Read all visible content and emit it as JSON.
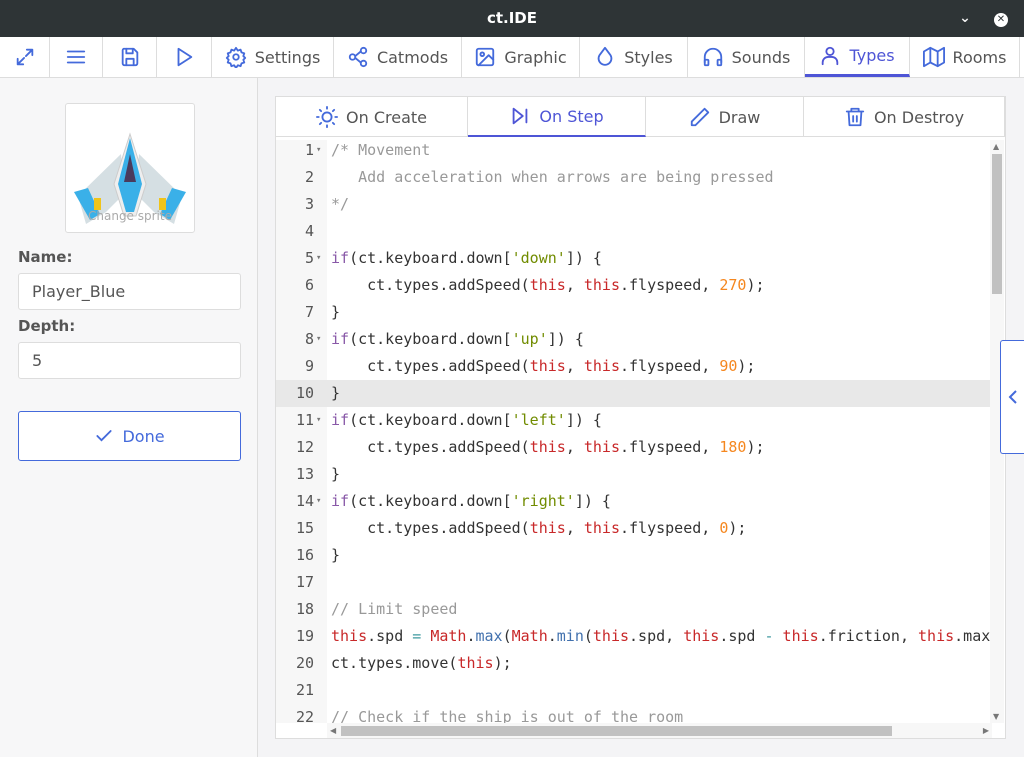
{
  "window": {
    "title": "ct.IDE"
  },
  "toolbar": {
    "tabs": [
      {
        "label": "",
        "icon": "expand-icon"
      },
      {
        "label": "",
        "icon": "menu-icon"
      },
      {
        "label": "",
        "icon": "save-icon"
      },
      {
        "label": "",
        "icon": "play-icon"
      },
      {
        "label": "Settings",
        "icon": "gear-icon"
      },
      {
        "label": "Catmods",
        "icon": "share-nodes-icon"
      },
      {
        "label": "Graphic",
        "icon": "image-icon"
      },
      {
        "label": "Styles",
        "icon": "droplet-icon"
      },
      {
        "label": "Sounds",
        "icon": "headphones-icon"
      },
      {
        "label": "Types",
        "icon": "user-icon",
        "active": true
      },
      {
        "label": "Rooms",
        "icon": "map-icon"
      }
    ]
  },
  "left": {
    "sprite_caption": "Change sprite",
    "name_label": "Name:",
    "name_value": "Player_Blue",
    "depth_label": "Depth:",
    "depth_value": "5",
    "done_label": "Done"
  },
  "editor": {
    "tabs": [
      {
        "label": "On Create",
        "icon": "sun-icon"
      },
      {
        "label": "On Step",
        "icon": "skip-forward-icon",
        "active": true
      },
      {
        "label": "Draw",
        "icon": "pencil-icon"
      },
      {
        "label": "On Destroy",
        "icon": "trash-icon"
      }
    ],
    "current_line": 10,
    "lines": [
      [
        [
          "cm",
          "/* Movement"
        ]
      ],
      [
        [
          "cm",
          "   Add acceleration when arrows are being pressed"
        ]
      ],
      [
        [
          "cm",
          "*/"
        ]
      ],
      [],
      [
        [
          "kw",
          "if"
        ],
        [
          "",
          "(ct.keyboard.down["
        ],
        [
          "st",
          "'down'"
        ],
        [
          "",
          "]) {"
        ]
      ],
      [
        [
          "",
          "    ct.types.addSpeed("
        ],
        [
          "th",
          "this"
        ],
        [
          "",
          ", "
        ],
        [
          "th",
          "this"
        ],
        [
          "",
          ".flyspeed, "
        ],
        [
          "nu",
          "270"
        ],
        [
          "",
          ");"
        ]
      ],
      [
        [
          "",
          "}"
        ]
      ],
      [
        [
          "kw",
          "if"
        ],
        [
          "",
          "(ct.keyboard.down["
        ],
        [
          "st",
          "'up'"
        ],
        [
          "",
          "]) {"
        ]
      ],
      [
        [
          "",
          "    ct.types.addSpeed("
        ],
        [
          "th",
          "this"
        ],
        [
          "",
          ", "
        ],
        [
          "th",
          "this"
        ],
        [
          "",
          ".flyspeed, "
        ],
        [
          "nu",
          "90"
        ],
        [
          "",
          ");"
        ]
      ],
      [
        [
          "",
          "}"
        ]
      ],
      [
        [
          "kw",
          "if"
        ],
        [
          "",
          "(ct.keyboard.down["
        ],
        [
          "st",
          "'left'"
        ],
        [
          "",
          "]) {"
        ]
      ],
      [
        [
          "",
          "    ct.types.addSpeed("
        ],
        [
          "th",
          "this"
        ],
        [
          "",
          ", "
        ],
        [
          "th",
          "this"
        ],
        [
          "",
          ".flyspeed, "
        ],
        [
          "nu",
          "180"
        ],
        [
          "",
          ");"
        ]
      ],
      [
        [
          "",
          "}"
        ]
      ],
      [
        [
          "kw",
          "if"
        ],
        [
          "",
          "(ct.keyboard.down["
        ],
        [
          "st",
          "'right'"
        ],
        [
          "",
          "]) {"
        ]
      ],
      [
        [
          "",
          "    ct.types.addSpeed("
        ],
        [
          "th",
          "this"
        ],
        [
          "",
          ", "
        ],
        [
          "th",
          "this"
        ],
        [
          "",
          ".flyspeed, "
        ],
        [
          "nu",
          "0"
        ],
        [
          "",
          ");"
        ]
      ],
      [
        [
          "",
          "}"
        ]
      ],
      [],
      [
        [
          "cm",
          "// Limit speed"
        ]
      ],
      [
        [
          "th",
          "this"
        ],
        [
          "",
          ".spd "
        ],
        [
          "op",
          "="
        ],
        [
          "th",
          " Math"
        ],
        [
          "",
          "."
        ],
        [
          "fn",
          "max"
        ],
        [
          "",
          "("
        ],
        [
          "th",
          "Math"
        ],
        [
          "",
          "."
        ],
        [
          "fn",
          "min"
        ],
        [
          "",
          "("
        ],
        [
          "th",
          "this"
        ],
        [
          "",
          ".spd, "
        ],
        [
          "th",
          "this"
        ],
        [
          "",
          ".spd "
        ],
        [
          "op",
          "-"
        ],
        [
          "th",
          " this"
        ],
        [
          "",
          ".friction, "
        ],
        [
          "th",
          "this"
        ],
        [
          "",
          ".maxspeed"
        ]
      ],
      [
        [
          "",
          "ct.types.move("
        ],
        [
          "th",
          "this"
        ],
        [
          "",
          ");"
        ]
      ],
      [],
      [
        [
          "cm",
          "// Check if the ship is out of the room"
        ]
      ]
    ],
    "fold_lines": [
      1,
      5,
      8,
      11,
      14
    ]
  }
}
